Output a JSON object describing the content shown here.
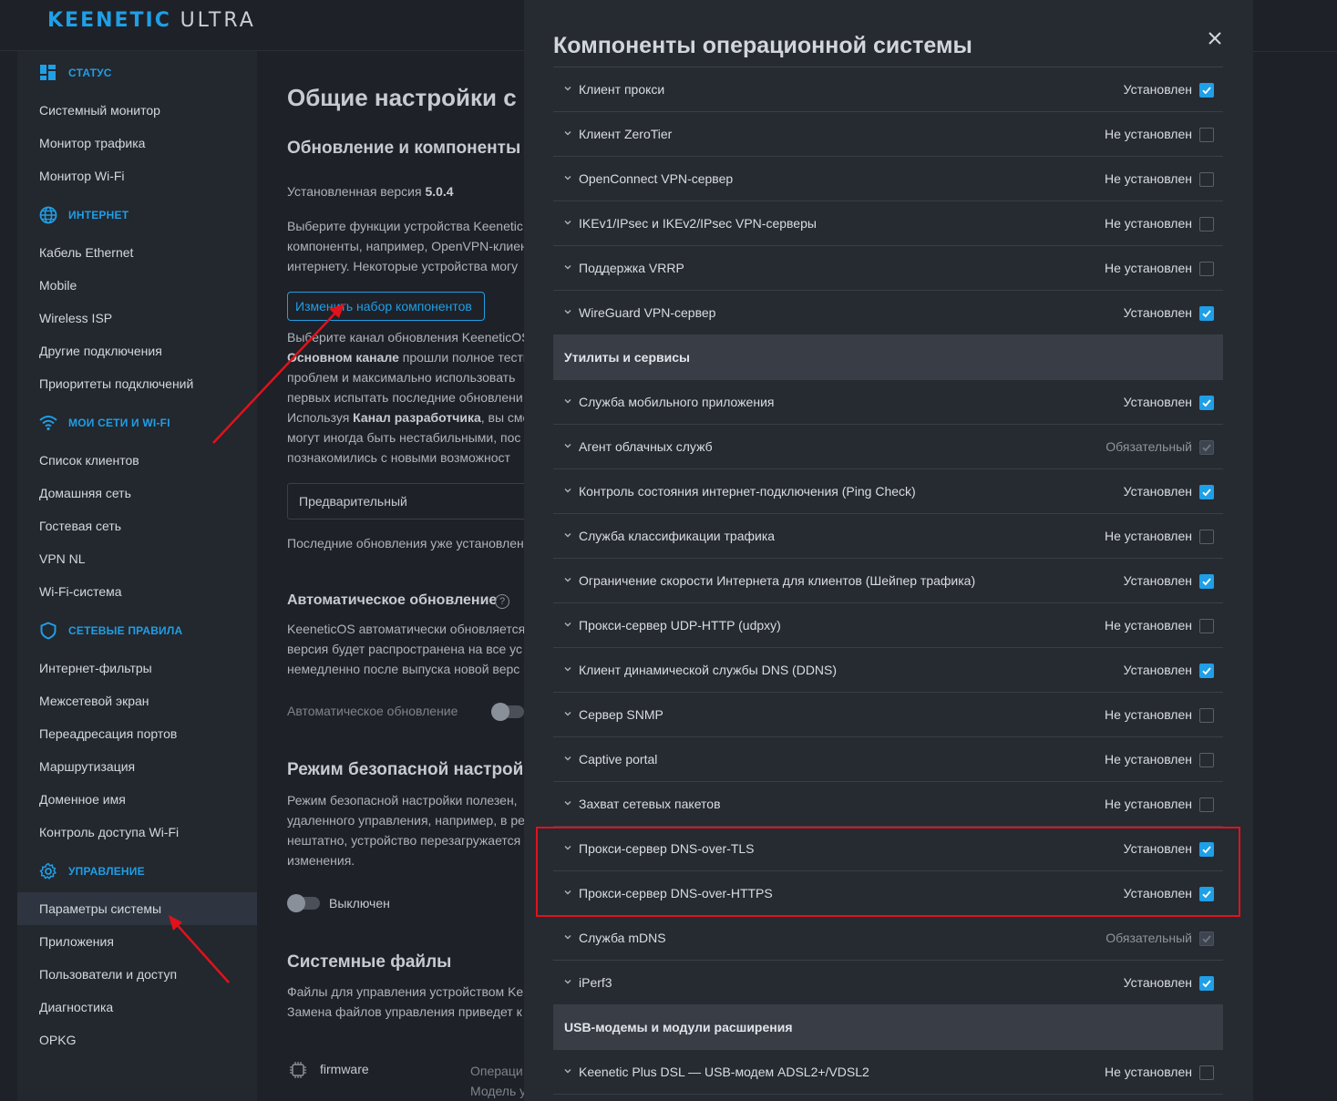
{
  "header": {
    "logo_brand": "KEENETIC",
    "logo_model": "ULTRA"
  },
  "sidebar": {
    "sections": [
      {
        "label": "Статус",
        "icon": "dashboard-icon"
      },
      {
        "label": "Интернет",
        "icon": "globe-icon"
      },
      {
        "label": "Мои сети и Wi-Fi",
        "icon": "wifi-icon"
      },
      {
        "label": "Сетевые правила",
        "icon": "shield-icon"
      },
      {
        "label": "Управление",
        "icon": "gear-icon"
      }
    ],
    "items": [
      "Системный монитор",
      "Монитор трафика",
      "Монитор Wi-Fi",
      "Кабель Ethernet",
      "Mobile",
      "Wireless ISP",
      "Другие подключения",
      "Приоритеты подключений",
      "Список клиентов",
      "Домашняя сеть",
      "Гостевая сеть",
      "VPN NL",
      "Wi-Fi-система",
      "Интернет-фильтры",
      "Межсетевой экран",
      "Переадресация портов",
      "Маршрутизация",
      "Доменное имя",
      "Контроль доступа Wi-Fi",
      "Параметры системы",
      "Приложения",
      "Пользователи и доступ",
      "Диагностика",
      "OPKG"
    ],
    "active_item": "Параметры системы"
  },
  "content": {
    "title": "Общие настройки с",
    "update_heading": "Обновление и компоненты",
    "installed_version_label": "Установленная версия",
    "installed_version": "5.0.4",
    "features_text": [
      "Выберите функции устройства Keenetic",
      "компоненты, например, OpenVPN-клиен",
      "интернету. Некоторые устройства могу"
    ],
    "change_components_button": "Изменить набор компонентов",
    "channel_text": [
      "Выберите канал обновления KeeneticOS",
      "прошли полное тести",
      "проблем и максимально использовать",
      "первых испытать последние обновлени",
      "Используя",
      ", вы смо",
      "могут иногда быть нестабильными, пос",
      "познакомились с новыми возможност"
    ],
    "channel_main_bold": "Основном канале",
    "channel_dev_bold": "Канал разработчика",
    "channel_select_value": "Предварительный",
    "latest_updates_text": "Последние обновления уже установлен",
    "auto_update_heading": "Автоматическое обновление",
    "auto_update_text": [
      "KeeneticOS автоматически обновляется",
      "версия будет распространена на все ус",
      "немедленно после выпуска новой верс"
    ],
    "auto_update_toggle_label": "Автоматическое обновление",
    "safe_mode_heading": "Режим безопасной настрой",
    "safe_mode_text": [
      "Режим безопасной настройки полезен,",
      "удаленного управления, например, в ре",
      "нештатно, устройство перезагружается",
      "изменения."
    ],
    "safe_mode_toggle_label": "Выключен",
    "system_files_heading": "Системные файлы",
    "system_files_text": [
      "Файлы для управления устройством Ke",
      "Замена файлов управления приведет к"
    ],
    "file_name": "firmware",
    "file_meta": [
      "Операци",
      "Модель у"
    ]
  },
  "modal": {
    "title": "Компоненты операционной системы",
    "close_label": "×",
    "rows": [
      {
        "type": "item",
        "name": "Клиент прокси",
        "status": "Установлен",
        "state": "on"
      },
      {
        "type": "item",
        "name": "Клиент ZeroTier",
        "status": "Не установлен",
        "state": "off"
      },
      {
        "type": "item",
        "name": "OpenConnect VPN-сервер",
        "status": "Не установлен",
        "state": "off"
      },
      {
        "type": "item",
        "name": "IKEv1/IPsec и IKEv2/IPsec VPN-серверы",
        "status": "Не установлен",
        "state": "off"
      },
      {
        "type": "item",
        "name": "Поддержка VRRP",
        "status": "Не установлен",
        "state": "off"
      },
      {
        "type": "item",
        "name": "WireGuard VPN-сервер",
        "status": "Установлен",
        "state": "on"
      },
      {
        "type": "group",
        "name": "Утилиты и сервисы"
      },
      {
        "type": "item",
        "name": "Служба мобильного приложения",
        "status": "Установлен",
        "state": "on"
      },
      {
        "type": "item",
        "name": "Агент облачных служб",
        "status": "Обязательный",
        "state": "required"
      },
      {
        "type": "item",
        "name": "Контроль состояния интернет-подключения (Ping Check)",
        "status": "Установлен",
        "state": "on"
      },
      {
        "type": "item",
        "name": "Служба классификации трафика",
        "status": "Не установлен",
        "state": "off"
      },
      {
        "type": "item",
        "name": "Ограничение скорости Интернета для клиентов (Шейпер трафика)",
        "status": "Установлен",
        "state": "on"
      },
      {
        "type": "item",
        "name": "Прокси-сервер UDP-HTTP (udpxy)",
        "status": "Не установлен",
        "state": "off"
      },
      {
        "type": "item",
        "name": "Клиент динамической службы DNS (DDNS)",
        "status": "Установлен",
        "state": "on"
      },
      {
        "type": "item",
        "name": "Сервер SNMP",
        "status": "Не установлен",
        "state": "off"
      },
      {
        "type": "item",
        "name": "Captive portal",
        "status": "Не установлен",
        "state": "off"
      },
      {
        "type": "item",
        "name": "Захват сетевых пакетов",
        "status": "Не установлен",
        "state": "off"
      },
      {
        "type": "item",
        "name": "Прокси-сервер DNS-over-TLS",
        "status": "Установлен",
        "state": "on"
      },
      {
        "type": "item",
        "name": "Прокси-сервер DNS-over-HTTPS",
        "status": "Установлен",
        "state": "on"
      },
      {
        "type": "item",
        "name": "Служба mDNS",
        "status": "Обязательный",
        "state": "required"
      },
      {
        "type": "item",
        "name": "iPerf3",
        "status": "Установлен",
        "state": "on"
      },
      {
        "type": "group",
        "name": "USB-модемы и модули расширения"
      },
      {
        "type": "item",
        "name": "Keenetic Plus DSL — USB-модем ADSL2+/VDSL2",
        "status": "Не установлен",
        "state": "off"
      }
    ]
  },
  "colors": {
    "accent": "#1f9fe6",
    "annotation": "#e0121c",
    "panel": "#262a31",
    "background": "#1e2127"
  }
}
